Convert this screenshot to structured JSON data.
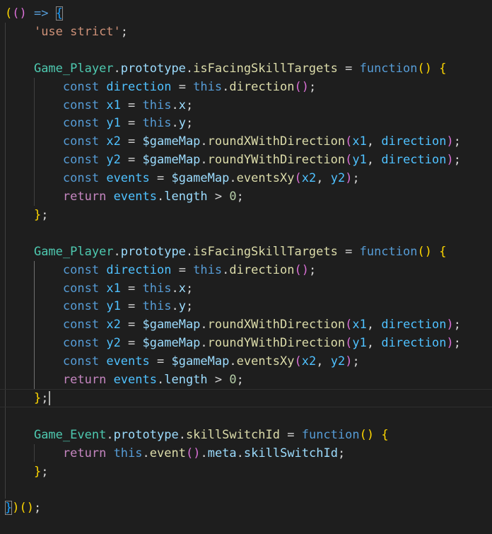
{
  "editor": {
    "language": "javascript",
    "theme_colors": {
      "background": "#1e1e1e",
      "keyword": "#569cd6",
      "control": "#c586c0",
      "string": "#ce9178",
      "class": "#4ec9b0",
      "function": "#dcdcaa",
      "variable": "#9cdcfe",
      "constant": "#4fc1ff",
      "number": "#b5cea8"
    },
    "lines": [
      [
        {
          "t": "(",
          "c": "brk"
        },
        {
          "t": "(",
          "c": "brk2"
        },
        {
          "t": ")",
          "c": "brk2"
        },
        {
          "t": " ",
          "c": "pl"
        },
        {
          "t": "=>",
          "c": "kw"
        },
        {
          "t": " ",
          "c": "pl"
        },
        {
          "t": "{",
          "c": "brk3 bracket-hl"
        }
      ],
      [
        {
          "t": "    ",
          "c": "pl"
        },
        {
          "t": "'use strict'",
          "c": "str"
        },
        {
          "t": ";",
          "c": "pl"
        }
      ],
      [],
      [
        {
          "t": "    ",
          "c": "pl"
        },
        {
          "t": "Game_Player",
          "c": "cls"
        },
        {
          "t": ".",
          "c": "pl"
        },
        {
          "t": "prototype",
          "c": "var"
        },
        {
          "t": ".",
          "c": "pl"
        },
        {
          "t": "isFacingSkillTargets",
          "c": "fn"
        },
        {
          "t": " = ",
          "c": "pl"
        },
        {
          "t": "function",
          "c": "kw"
        },
        {
          "t": "(",
          "c": "brk"
        },
        {
          "t": ")",
          "c": "brk"
        },
        {
          "t": " ",
          "c": "pl"
        },
        {
          "t": "{",
          "c": "brk"
        }
      ],
      [
        {
          "t": "        ",
          "c": "pl"
        },
        {
          "t": "const",
          "c": "kw"
        },
        {
          "t": " ",
          "c": "pl"
        },
        {
          "t": "direction",
          "c": "cst"
        },
        {
          "t": " = ",
          "c": "pl"
        },
        {
          "t": "this",
          "c": "kw"
        },
        {
          "t": ".",
          "c": "pl"
        },
        {
          "t": "direction",
          "c": "fn"
        },
        {
          "t": "(",
          "c": "brk2"
        },
        {
          "t": ")",
          "c": "brk2"
        },
        {
          "t": ";",
          "c": "pl"
        }
      ],
      [
        {
          "t": "        ",
          "c": "pl"
        },
        {
          "t": "const",
          "c": "kw"
        },
        {
          "t": " ",
          "c": "pl"
        },
        {
          "t": "x1",
          "c": "cst"
        },
        {
          "t": " = ",
          "c": "pl"
        },
        {
          "t": "this",
          "c": "kw"
        },
        {
          "t": ".",
          "c": "pl"
        },
        {
          "t": "x",
          "c": "var"
        },
        {
          "t": ";",
          "c": "pl"
        }
      ],
      [
        {
          "t": "        ",
          "c": "pl"
        },
        {
          "t": "const",
          "c": "kw"
        },
        {
          "t": " ",
          "c": "pl"
        },
        {
          "t": "y1",
          "c": "cst"
        },
        {
          "t": " = ",
          "c": "pl"
        },
        {
          "t": "this",
          "c": "kw"
        },
        {
          "t": ".",
          "c": "pl"
        },
        {
          "t": "y",
          "c": "var"
        },
        {
          "t": ";",
          "c": "pl"
        }
      ],
      [
        {
          "t": "        ",
          "c": "pl"
        },
        {
          "t": "const",
          "c": "kw"
        },
        {
          "t": " ",
          "c": "pl"
        },
        {
          "t": "x2",
          "c": "cst"
        },
        {
          "t": " = ",
          "c": "pl"
        },
        {
          "t": "$gameMap",
          "c": "var"
        },
        {
          "t": ".",
          "c": "pl"
        },
        {
          "t": "roundXWithDirection",
          "c": "fn"
        },
        {
          "t": "(",
          "c": "brk2"
        },
        {
          "t": "x1",
          "c": "cst"
        },
        {
          "t": ", ",
          "c": "pl"
        },
        {
          "t": "direction",
          "c": "cst"
        },
        {
          "t": ")",
          "c": "brk2"
        },
        {
          "t": ";",
          "c": "pl"
        }
      ],
      [
        {
          "t": "        ",
          "c": "pl"
        },
        {
          "t": "const",
          "c": "kw"
        },
        {
          "t": " ",
          "c": "pl"
        },
        {
          "t": "y2",
          "c": "cst"
        },
        {
          "t": " = ",
          "c": "pl"
        },
        {
          "t": "$gameMap",
          "c": "var"
        },
        {
          "t": ".",
          "c": "pl"
        },
        {
          "t": "roundYWithDirection",
          "c": "fn"
        },
        {
          "t": "(",
          "c": "brk2"
        },
        {
          "t": "y1",
          "c": "cst"
        },
        {
          "t": ", ",
          "c": "pl"
        },
        {
          "t": "direction",
          "c": "cst"
        },
        {
          "t": ")",
          "c": "brk2"
        },
        {
          "t": ";",
          "c": "pl"
        }
      ],
      [
        {
          "t": "        ",
          "c": "pl"
        },
        {
          "t": "const",
          "c": "kw"
        },
        {
          "t": " ",
          "c": "pl"
        },
        {
          "t": "events",
          "c": "cst"
        },
        {
          "t": " = ",
          "c": "pl"
        },
        {
          "t": "$gameMap",
          "c": "var"
        },
        {
          "t": ".",
          "c": "pl"
        },
        {
          "t": "eventsXy",
          "c": "fn"
        },
        {
          "t": "(",
          "c": "brk2"
        },
        {
          "t": "x2",
          "c": "cst"
        },
        {
          "t": ", ",
          "c": "pl"
        },
        {
          "t": "y2",
          "c": "cst"
        },
        {
          "t": ")",
          "c": "brk2"
        },
        {
          "t": ";",
          "c": "pl"
        }
      ],
      [
        {
          "t": "        ",
          "c": "pl"
        },
        {
          "t": "return",
          "c": "ctl"
        },
        {
          "t": " ",
          "c": "pl"
        },
        {
          "t": "events",
          "c": "cst"
        },
        {
          "t": ".",
          "c": "pl"
        },
        {
          "t": "length",
          "c": "var"
        },
        {
          "t": " > ",
          "c": "pl"
        },
        {
          "t": "0",
          "c": "num"
        },
        {
          "t": ";",
          "c": "pl"
        }
      ],
      [
        {
          "t": "    ",
          "c": "pl"
        },
        {
          "t": "}",
          "c": "brk"
        },
        {
          "t": ";",
          "c": "pl"
        }
      ],
      [],
      [
        {
          "t": "    ",
          "c": "pl"
        },
        {
          "t": "Game_Player",
          "c": "cls"
        },
        {
          "t": ".",
          "c": "pl"
        },
        {
          "t": "prototype",
          "c": "var"
        },
        {
          "t": ".",
          "c": "pl"
        },
        {
          "t": "isFacingSkillTargets",
          "c": "fn"
        },
        {
          "t": " = ",
          "c": "pl"
        },
        {
          "t": "function",
          "c": "kw"
        },
        {
          "t": "(",
          "c": "brk"
        },
        {
          "t": ")",
          "c": "brk"
        },
        {
          "t": " ",
          "c": "pl"
        },
        {
          "t": "{",
          "c": "brk"
        }
      ],
      [
        {
          "t": "        ",
          "c": "pl"
        },
        {
          "t": "const",
          "c": "kw"
        },
        {
          "t": " ",
          "c": "pl"
        },
        {
          "t": "direction",
          "c": "cst"
        },
        {
          "t": " = ",
          "c": "pl"
        },
        {
          "t": "this",
          "c": "kw"
        },
        {
          "t": ".",
          "c": "pl"
        },
        {
          "t": "direction",
          "c": "fn"
        },
        {
          "t": "(",
          "c": "brk2"
        },
        {
          "t": ")",
          "c": "brk2"
        },
        {
          "t": ";",
          "c": "pl"
        }
      ],
      [
        {
          "t": "        ",
          "c": "pl"
        },
        {
          "t": "const",
          "c": "kw"
        },
        {
          "t": " ",
          "c": "pl"
        },
        {
          "t": "x1",
          "c": "cst"
        },
        {
          "t": " = ",
          "c": "pl"
        },
        {
          "t": "this",
          "c": "kw"
        },
        {
          "t": ".",
          "c": "pl"
        },
        {
          "t": "x",
          "c": "var"
        },
        {
          "t": ";",
          "c": "pl"
        }
      ],
      [
        {
          "t": "        ",
          "c": "pl"
        },
        {
          "t": "const",
          "c": "kw"
        },
        {
          "t": " ",
          "c": "pl"
        },
        {
          "t": "y1",
          "c": "cst"
        },
        {
          "t": " = ",
          "c": "pl"
        },
        {
          "t": "this",
          "c": "kw"
        },
        {
          "t": ".",
          "c": "pl"
        },
        {
          "t": "y",
          "c": "var"
        },
        {
          "t": ";",
          "c": "pl"
        }
      ],
      [
        {
          "t": "        ",
          "c": "pl"
        },
        {
          "t": "const",
          "c": "kw"
        },
        {
          "t": " ",
          "c": "pl"
        },
        {
          "t": "x2",
          "c": "cst"
        },
        {
          "t": " = ",
          "c": "pl"
        },
        {
          "t": "$gameMap",
          "c": "var"
        },
        {
          "t": ".",
          "c": "pl"
        },
        {
          "t": "roundXWithDirection",
          "c": "fn"
        },
        {
          "t": "(",
          "c": "brk2"
        },
        {
          "t": "x1",
          "c": "cst"
        },
        {
          "t": ", ",
          "c": "pl"
        },
        {
          "t": "direction",
          "c": "cst"
        },
        {
          "t": ")",
          "c": "brk2"
        },
        {
          "t": ";",
          "c": "pl"
        }
      ],
      [
        {
          "t": "        ",
          "c": "pl"
        },
        {
          "t": "const",
          "c": "kw"
        },
        {
          "t": " ",
          "c": "pl"
        },
        {
          "t": "y2",
          "c": "cst"
        },
        {
          "t": " = ",
          "c": "pl"
        },
        {
          "t": "$gameMap",
          "c": "var"
        },
        {
          "t": ".",
          "c": "pl"
        },
        {
          "t": "roundYWithDirection",
          "c": "fn"
        },
        {
          "t": "(",
          "c": "brk2"
        },
        {
          "t": "y1",
          "c": "cst"
        },
        {
          "t": ", ",
          "c": "pl"
        },
        {
          "t": "direction",
          "c": "cst"
        },
        {
          "t": ")",
          "c": "brk2"
        },
        {
          "t": ";",
          "c": "pl"
        }
      ],
      [
        {
          "t": "        ",
          "c": "pl"
        },
        {
          "t": "const",
          "c": "kw"
        },
        {
          "t": " ",
          "c": "pl"
        },
        {
          "t": "events",
          "c": "cst"
        },
        {
          "t": " = ",
          "c": "pl"
        },
        {
          "t": "$gameMap",
          "c": "var"
        },
        {
          "t": ".",
          "c": "pl"
        },
        {
          "t": "eventsXy",
          "c": "fn"
        },
        {
          "t": "(",
          "c": "brk2"
        },
        {
          "t": "x2",
          "c": "cst"
        },
        {
          "t": ", ",
          "c": "pl"
        },
        {
          "t": "y2",
          "c": "cst"
        },
        {
          "t": ")",
          "c": "brk2"
        },
        {
          "t": ";",
          "c": "pl"
        }
      ],
      [
        {
          "t": "        ",
          "c": "pl"
        },
        {
          "t": "return",
          "c": "ctl"
        },
        {
          "t": " ",
          "c": "pl"
        },
        {
          "t": "events",
          "c": "cst"
        },
        {
          "t": ".",
          "c": "pl"
        },
        {
          "t": "length",
          "c": "var"
        },
        {
          "t": " > ",
          "c": "pl"
        },
        {
          "t": "0",
          "c": "num"
        },
        {
          "t": ";",
          "c": "pl"
        }
      ],
      [
        {
          "t": "    ",
          "c": "pl"
        },
        {
          "t": "}",
          "c": "brk"
        },
        {
          "t": ";",
          "c": "pl"
        }
      ],
      [],
      [
        {
          "t": "    ",
          "c": "pl"
        },
        {
          "t": "Game_Event",
          "c": "cls"
        },
        {
          "t": ".",
          "c": "pl"
        },
        {
          "t": "prototype",
          "c": "var"
        },
        {
          "t": ".",
          "c": "pl"
        },
        {
          "t": "skillSwitchId",
          "c": "fn"
        },
        {
          "t": " = ",
          "c": "pl"
        },
        {
          "t": "function",
          "c": "kw"
        },
        {
          "t": "(",
          "c": "brk"
        },
        {
          "t": ")",
          "c": "brk"
        },
        {
          "t": " ",
          "c": "pl"
        },
        {
          "t": "{",
          "c": "brk"
        }
      ],
      [
        {
          "t": "        ",
          "c": "pl"
        },
        {
          "t": "return",
          "c": "ctl"
        },
        {
          "t": " ",
          "c": "pl"
        },
        {
          "t": "this",
          "c": "kw"
        },
        {
          "t": ".",
          "c": "pl"
        },
        {
          "t": "event",
          "c": "fn"
        },
        {
          "t": "(",
          "c": "brk2"
        },
        {
          "t": ")",
          "c": "brk2"
        },
        {
          "t": ".",
          "c": "pl"
        },
        {
          "t": "meta",
          "c": "var"
        },
        {
          "t": ".",
          "c": "pl"
        },
        {
          "t": "skillSwitchId",
          "c": "var"
        },
        {
          "t": ";",
          "c": "pl"
        }
      ],
      [
        {
          "t": "    ",
          "c": "pl"
        },
        {
          "t": "}",
          "c": "brk"
        },
        {
          "t": ";",
          "c": "pl"
        }
      ],
      [],
      [
        {
          "t": "}",
          "c": "brk3 bracket-hl"
        },
        {
          "t": ")",
          "c": "brk"
        },
        {
          "t": "(",
          "c": "brk"
        },
        {
          "t": ")",
          "c": "brk"
        },
        {
          "t": ";",
          "c": "pl"
        }
      ]
    ]
  }
}
